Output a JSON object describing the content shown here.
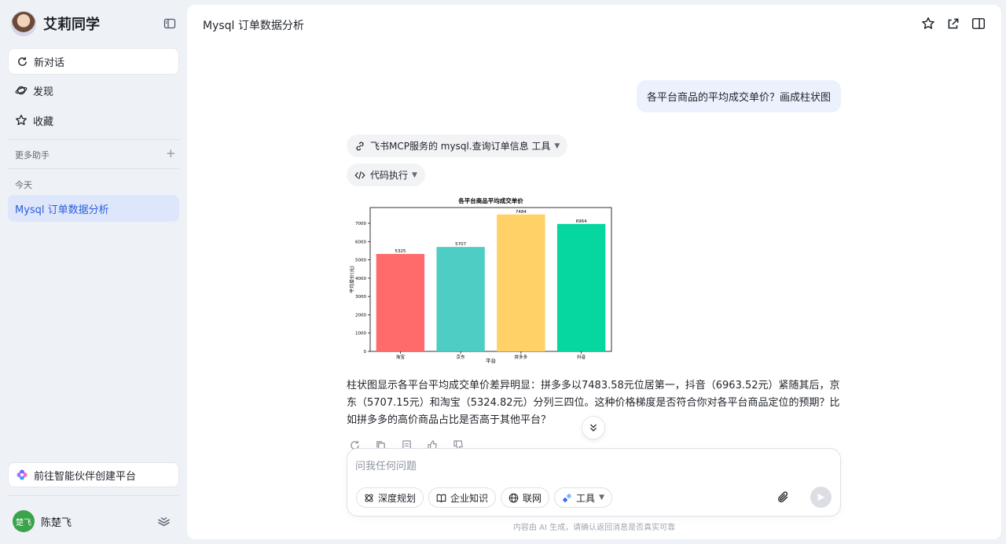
{
  "sidebar": {
    "brand_name": "艾莉同学",
    "nav": {
      "new_chat": "新对话",
      "discover": "发现",
      "favorites": "收藏"
    },
    "more_assistants": "更多助手",
    "today": "今天",
    "chats": [
      "Mysql 订单数据分析"
    ],
    "partner_platform": "前往智能伙伴创建平台",
    "user": {
      "avatar_text": "楚飞",
      "name": "陈楚飞",
      "avatar_color": "#3aa34b"
    }
  },
  "main": {
    "title": "Mysql 订单数据分析",
    "user_message": "各平台商品的平均成交单价？画成柱状图",
    "tool_call_label": "飞书MCP服务的 mysql.查询订单信息 工具",
    "code_exec_label": "代码执行",
    "answer": "柱状图显示各平台平均成交单价差异明显：拼多多以7483.58元位居第一，抖音（6963.52元）紧随其后，京东（5707.15元）和淘宝（5324.82元）分列三四位。这种价格梯度是否符合你对各平台商品定位的预期？比如拼多多的高价商品占比是否高于其他平台？",
    "composer": {
      "placeholder": "问我任何问题",
      "chips": [
        "深度规划",
        "企业知识",
        "联网",
        "工具"
      ]
    },
    "disclaimer": "内容由 AI 生成，请确认返回消息是否真实可靠"
  },
  "colors": {
    "accent": "#2b5fd9",
    "selected_bg": "#dde6fb",
    "user_bubble": "#ecf2fd"
  },
  "chart_data": {
    "type": "bar",
    "title": "各平台商品平均成交单价",
    "xlabel": "平台",
    "ylabel": "平均单价(元)",
    "categories": [
      "淘宝",
      "京东",
      "拼多多",
      "抖音"
    ],
    "values": [
      5325,
      5707,
      7484,
      6964
    ],
    "colors": [
      "#ff6b6b",
      "#4ecdc4",
      "#ffd166",
      "#06d6a0"
    ],
    "ylim": [
      0,
      7860
    ],
    "yticks": [
      0,
      1000,
      2000,
      3000,
      4000,
      5000,
      6000,
      7000
    ],
    "grid": false
  }
}
